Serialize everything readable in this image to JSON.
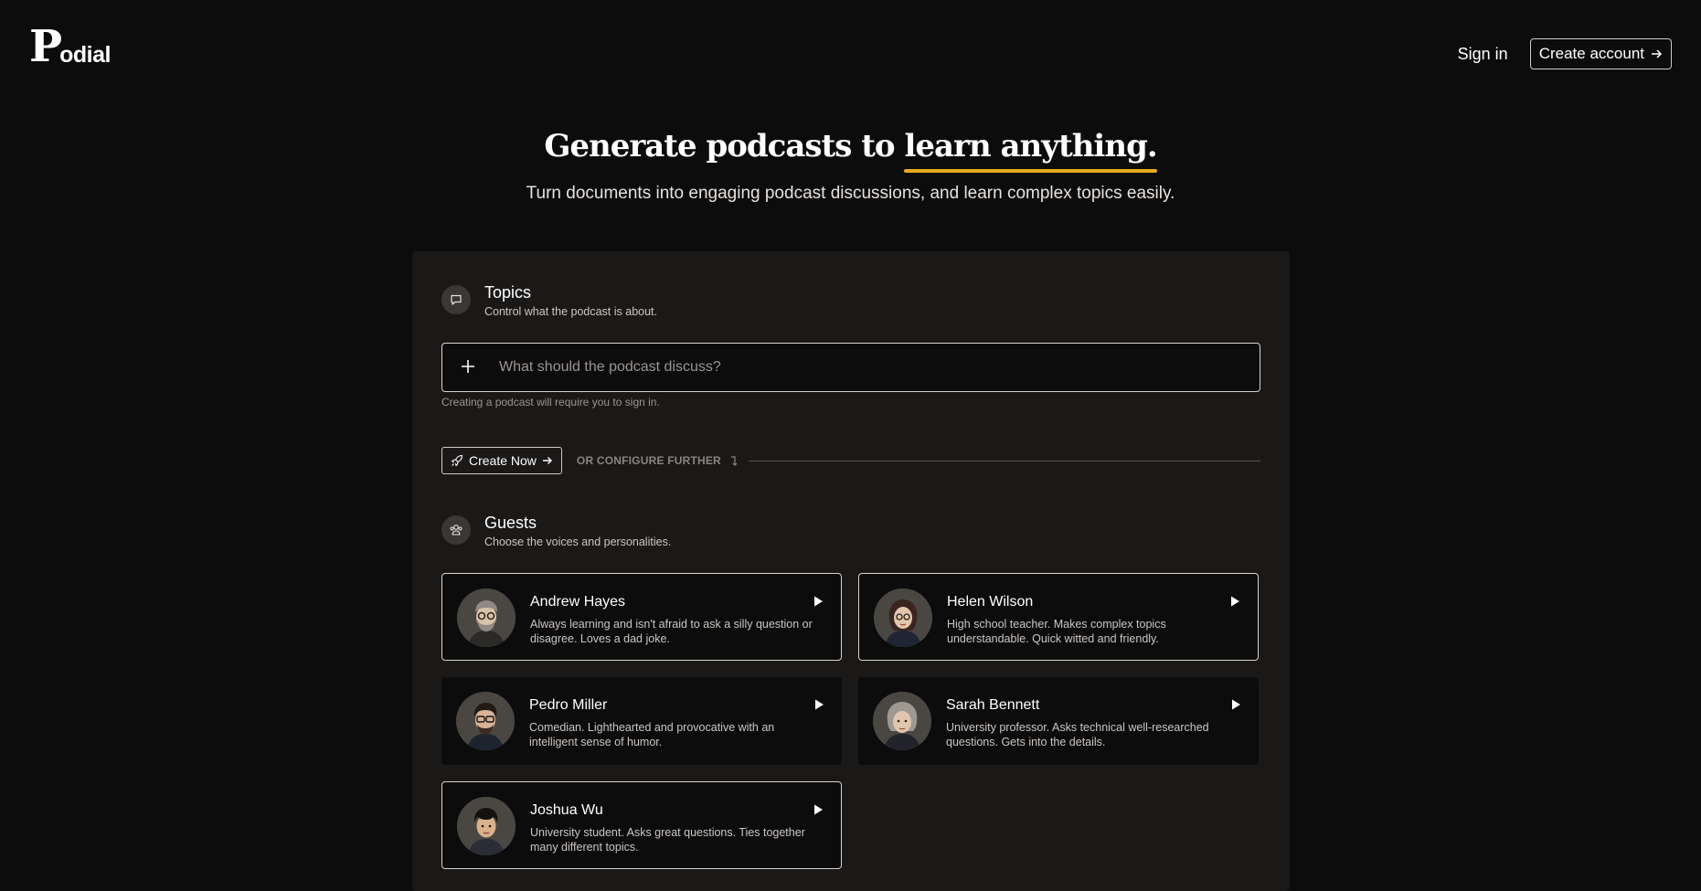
{
  "header": {
    "logo_initial": "P",
    "logo_rest": "odial",
    "sign_in": "Sign in",
    "create_account": "Create account"
  },
  "hero": {
    "title_start": "Generate podcasts to ",
    "title_highlight": "learn anything.",
    "subtitle": "Turn documents into engaging podcast discussions, and learn complex topics easily."
  },
  "topics": {
    "title": "Topics",
    "description": "Control what the podcast is about.",
    "input_placeholder": "What should the podcast discuss?",
    "hint": "Creating a podcast will require you to sign in.",
    "create_now": "Create Now",
    "configure_label": "OR CONFIGURE FURTHER"
  },
  "guests": {
    "title": "Guests",
    "description": "Choose the voices and personalities.",
    "items": [
      {
        "name": "Andrew Hayes",
        "description": "Always learning and isn't afraid to ask a silly question or disagree. Loves a dad joke.",
        "selected": true
      },
      {
        "name": "Helen Wilson",
        "description": "High school teacher. Makes complex topics understandable. Quick witted and friendly.",
        "selected": true
      },
      {
        "name": "Pedro Miller",
        "description": "Comedian. Lighthearted and provocative with an intelligent sense of humor.",
        "selected": false
      },
      {
        "name": "Sarah Bennett",
        "description": "University professor. Asks technical well-researched questions. Gets into the details.",
        "selected": false
      },
      {
        "name": "Joshua Wu",
        "description": "University student. Asks great questions. Ties together many different topics.",
        "selected": true
      }
    ]
  },
  "colors": {
    "background": "#0d0c0c",
    "panel": "#1b1918",
    "accent_underline": "#e8aa1d"
  }
}
